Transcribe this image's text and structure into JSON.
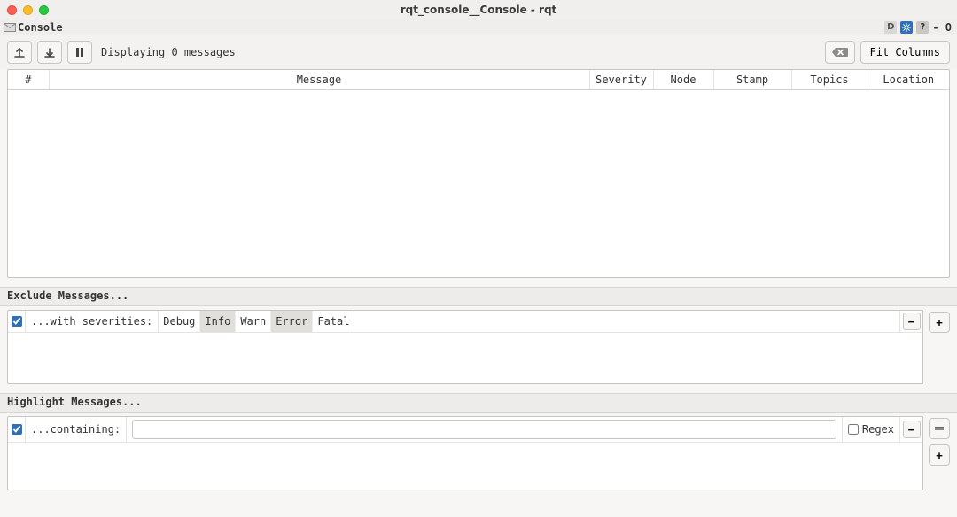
{
  "window": {
    "title": "rqt_console__Console - rqt"
  },
  "dock": {
    "label": "Console",
    "right_text": "- O"
  },
  "toolbar": {
    "status": "Displaying 0 messages",
    "fit_columns_label": "Fit Columns"
  },
  "table": {
    "columns": [
      "#",
      "Message",
      "Severity",
      "Node",
      "Stamp",
      "Topics",
      "Location"
    ]
  },
  "exclude": {
    "title": "Exclude Messages...",
    "rows": [
      {
        "enabled": true,
        "label": "...with severities:",
        "severities": [
          {
            "name": "Debug",
            "active": false
          },
          {
            "name": "Info",
            "active": true
          },
          {
            "name": "Warn",
            "active": false
          },
          {
            "name": "Error",
            "active": true
          },
          {
            "name": "Fatal",
            "active": false
          }
        ]
      }
    ]
  },
  "highlight": {
    "title": "Highlight Messages...",
    "rows": [
      {
        "enabled": true,
        "label": "...containing:",
        "value": "",
        "regex_label": "Regex",
        "regex_checked": false
      }
    ]
  },
  "buttons": {
    "minus": "−",
    "plus": "+"
  }
}
